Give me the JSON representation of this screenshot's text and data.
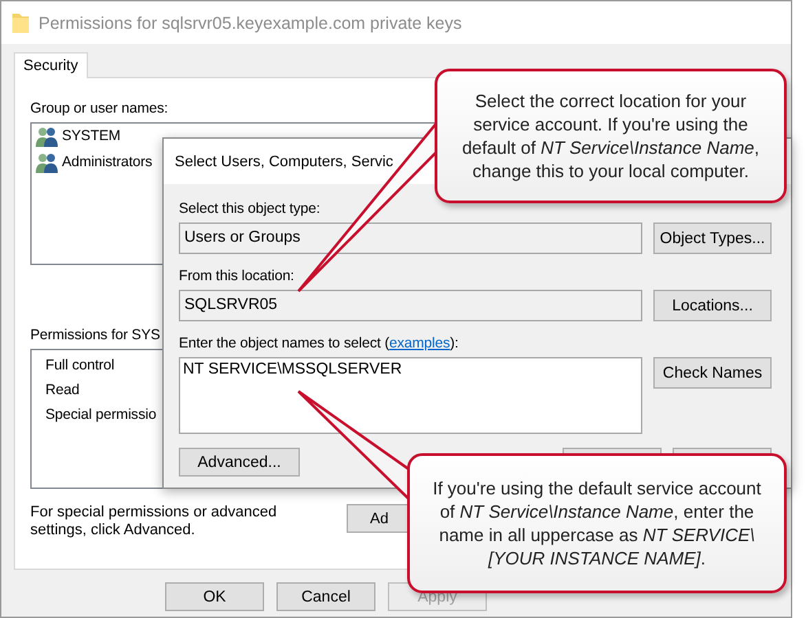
{
  "window": {
    "title": "Permissions for sqlsrvr05.keyexample.com private keys"
  },
  "tabs": [
    {
      "label": "Security",
      "selected": true
    }
  ],
  "group_label": "Group or user names:",
  "users": [
    {
      "name": "SYSTEM"
    },
    {
      "name": "Administrators"
    }
  ],
  "permissions_label": "Permissions for SYS",
  "permissions": [
    "Full control",
    "Read",
    "Special permissio"
  ],
  "advanced_note": "For special permissions or advanced settings, click Advanced.",
  "advanced_button": "Ad",
  "buttons": [
    {
      "label": "OK",
      "disabled": false
    },
    {
      "label": "Cancel",
      "disabled": false
    },
    {
      "label": "Apply",
      "disabled": true
    }
  ],
  "dialog": {
    "title": "Select Users, Computers, Servic",
    "object_type_label": "Select this object type:",
    "object_type": "Users or Groups",
    "object_types_button": "Object Types...",
    "location_label": "From this location:",
    "location": "SQLSRVR05",
    "locations_button": "Locations...",
    "names_label": "Enter the object names to select (",
    "names_link": "examples",
    "names_label_end": "):",
    "names": "NT SERVICE\\MSSQLSERVER",
    "check_names_button": "Check Names",
    "advanced_button": "Advanced..."
  },
  "callouts": [
    {
      "text": "Select the correct location for your service account. If you're using the default of *NT Service\\Instance Name*, change this to your local computer."
    },
    {
      "text": "If you're using the default service account of *NT Service\\Instance Name*, enter the name in all uppercase as *NT SERVICE\\[YOUR INSTANCE NAME]*."
    }
  ]
}
